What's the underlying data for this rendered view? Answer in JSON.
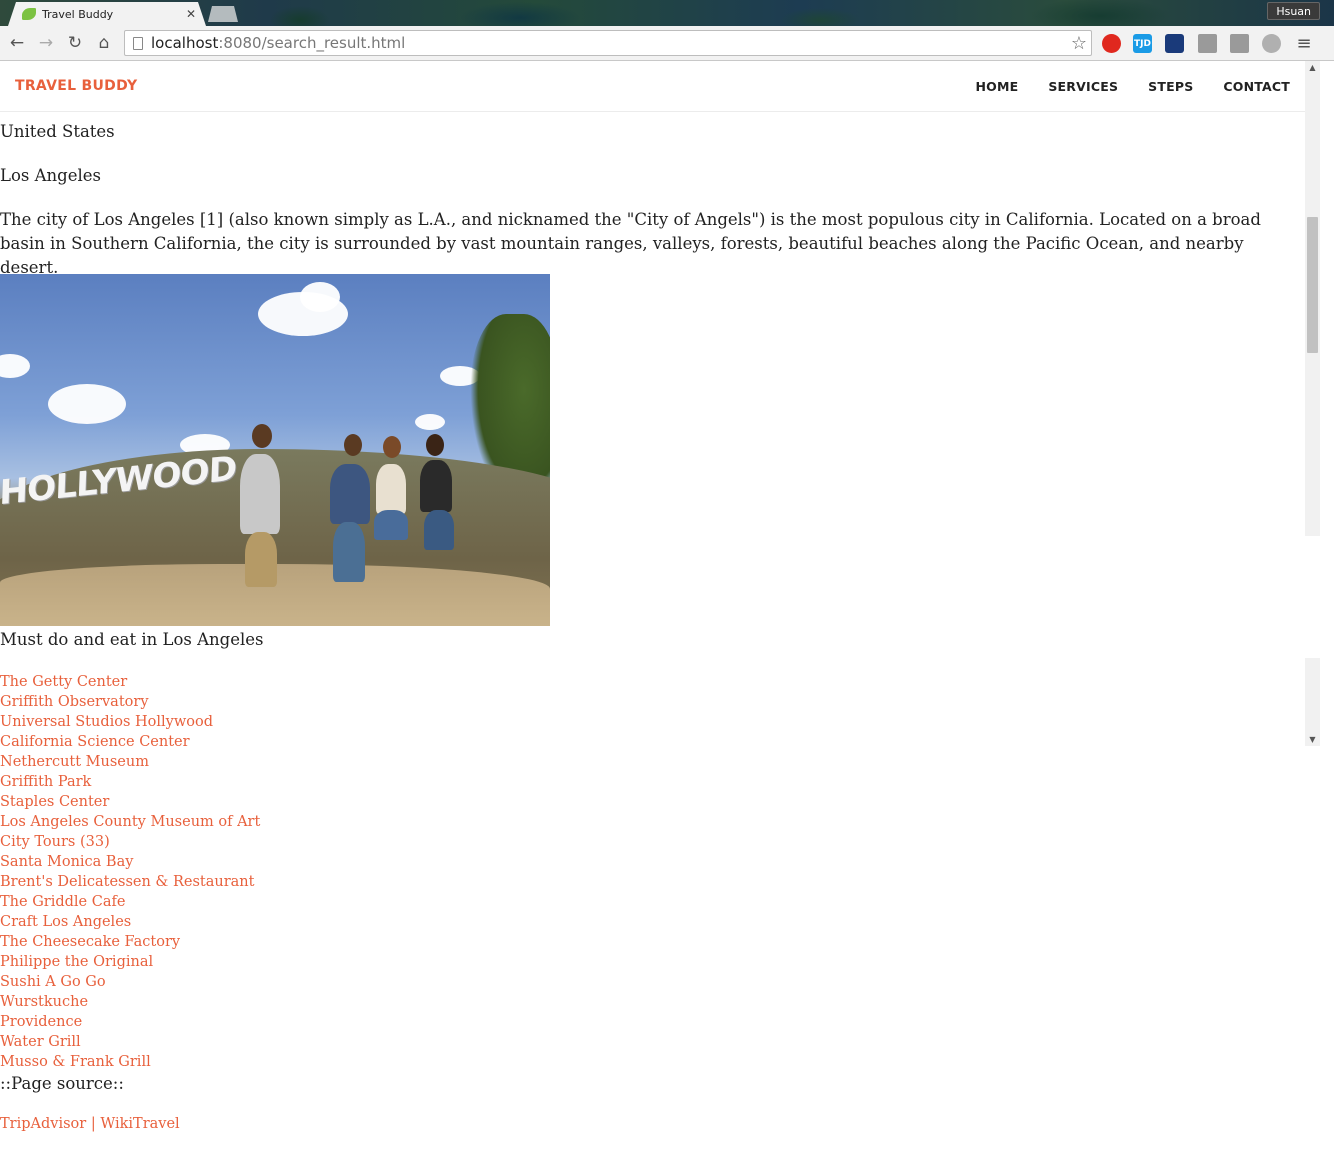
{
  "browser": {
    "tab_title": "Travel Buddy",
    "tab_close": "✕",
    "profile_name": "Hsuan",
    "url_host": "localhost",
    "url_path": ":8080/search_result.html",
    "extensions": [
      {
        "name": "opera-icon",
        "label": "",
        "color": "#e0281e"
      },
      {
        "name": "tjd-icon",
        "label": "TJD",
        "color": "#1a9be6"
      },
      {
        "name": "stats-icon",
        "label": "",
        "color": "#1a3a7a"
      },
      {
        "name": "puzzle-icon",
        "label": "",
        "color": "#9a9a9a"
      },
      {
        "name": "window-icon",
        "label": "",
        "color": "#9a9a9a"
      },
      {
        "name": "circle-m-icon",
        "label": "",
        "color": "#b0b0b0"
      }
    ]
  },
  "site": {
    "brand": "TRAVEL BUDDY",
    "brand_color": "#e8603c",
    "menu": [
      "HOME",
      "SERVICES",
      "STEPS",
      "CONTACT"
    ]
  },
  "result": {
    "country": "United States",
    "city": "Los Angeles",
    "description": "The city of Los Angeles [1] (also known simply as L.A., and nicknamed the \"City of Angels\") is the most populous city in California. Located on a broad basin in Southern California, the city is surrounded by vast mountain ranges, valleys, forests, beautiful beaches along the Pacific Ocean, and nearby desert.",
    "image_sign_text": "HOLLYWOOD",
    "must_heading": "Must do and eat in Los Angeles",
    "attractions": [
      "The Getty Center",
      "Griffith Observatory",
      "Universal Studios Hollywood",
      "California Science Center",
      "Nethercutt Museum",
      "Griffith Park",
      "Staples Center",
      "Los Angeles County Museum of Art",
      "City Tours (33)",
      "Santa Monica Bay",
      "Brent's Delicatessen & Restaurant",
      "The Griddle Cafe",
      "Craft Los Angeles",
      "The Cheesecake Factory",
      "Philippe the Original",
      "Sushi A Go Go",
      "Wurstkuche",
      "Providence",
      "Water Grill",
      "Musso & Frank Grill"
    ],
    "source_heading": "::Page source::",
    "sources": [
      "TripAdvisor",
      "WikiTravel"
    ],
    "source_separator": "|"
  }
}
